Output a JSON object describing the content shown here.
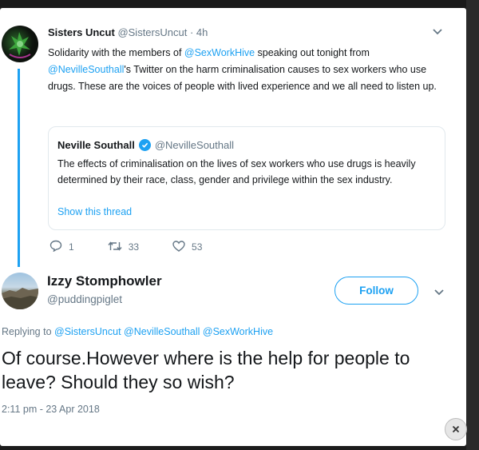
{
  "tweet": {
    "name": "Sisters Uncut",
    "handle": "@SistersUncut",
    "sep": "·",
    "time": "4h",
    "text_parts": [
      "Solidarity with the members of ",
      "@SexWorkHive",
      " speaking out tonight from ",
      "@NevilleSouthall",
      "'s Twitter on the harm criminalisation causes to sex workers who use drugs. These are the voices of people with lived experience and we all need to listen up."
    ],
    "quote": {
      "name": "Neville Southall",
      "handle": "@NevilleSouthall",
      "text": "The effects of criminalisation on the lives of sex workers who use drugs is heavily determined by their race, class, gender and privilege within the sex industry.",
      "show_thread": "Show this thread"
    },
    "actions": {
      "replies": "1",
      "retweets": "33",
      "likes": "53"
    }
  },
  "reply": {
    "name": "Izzy Stomphowler",
    "handle": "@puddingpiglet",
    "follow_label": "Follow",
    "replying_prefix": "Replying to ",
    "replying_to": "@SistersUncut @NevilleSouthall @SexWorkHive",
    "text": "Of course.However where is the help for people to leave? Should they so wish?",
    "timestamp": "2:11 pm - 23 Apr 2018"
  },
  "colors": {
    "accent": "#1da1f2",
    "muted": "#657786",
    "text": "#14171a"
  },
  "icons": {
    "caret": "chevron-down-icon",
    "close": "close-icon"
  }
}
